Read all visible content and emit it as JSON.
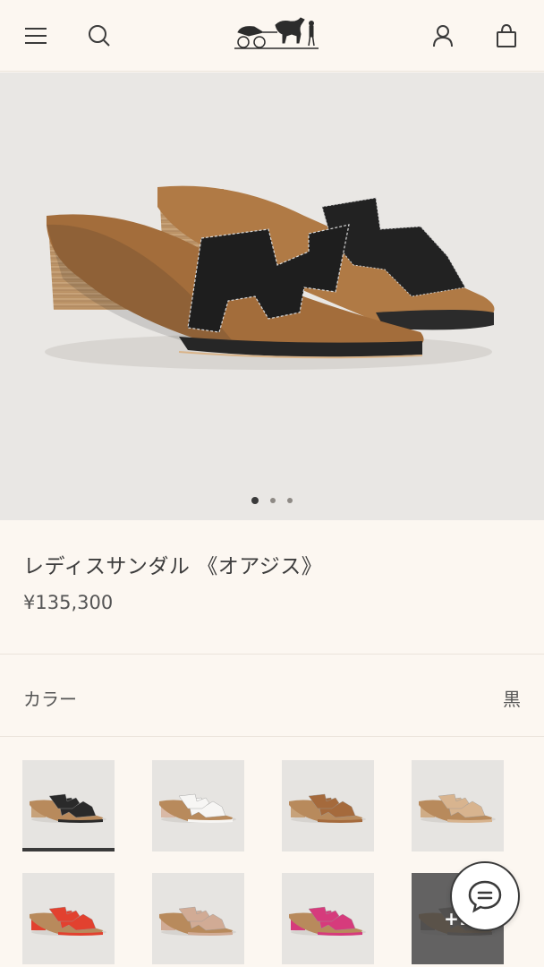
{
  "header": {
    "menu_icon": "hamburger-menu-icon",
    "search_icon": "search-icon",
    "logo": "horse-carriage-logo",
    "account_icon": "account-icon",
    "bag_icon": "shopping-bag-icon"
  },
  "gallery": {
    "image": "black-leather-heeled-sandal",
    "slides": 3,
    "active_slide": 1
  },
  "product": {
    "title": "レディスサンダル 《オアジス》",
    "price": "¥135,300"
  },
  "color": {
    "label": "カラー",
    "value": "黒"
  },
  "swatches": [
    {
      "name": "black",
      "strap": "#2a2a2a",
      "heel": "#c7a27a",
      "selected": true
    },
    {
      "name": "white",
      "strap": "#f7f6f4",
      "heel": "#d9b9a6",
      "selected": false
    },
    {
      "name": "tan",
      "strap": "#a56a3c",
      "heel": "#c7a27a",
      "selected": false
    },
    {
      "name": "beige",
      "strap": "#d8b48f",
      "heel": "#cfac86",
      "selected": false
    },
    {
      "name": "red",
      "strap": "#e2412f",
      "heel": "#e2412f",
      "selected": false
    },
    {
      "name": "rose-beige",
      "strap": "#d1ab95",
      "heel": "#d1ab95",
      "selected": false
    },
    {
      "name": "pink",
      "strap": "#d63b7c",
      "heel": "#d63b7c",
      "selected": false
    },
    {
      "name": "more",
      "strap": "#8a7f78",
      "heel": "#8a7f78",
      "selected": false
    }
  ],
  "more_label": "+1",
  "chat_icon": "chat-bubble-icon",
  "colors": {
    "background": "#fcf7f1",
    "gallery_bg": "#e9e7e4",
    "text": "#3d3d3d"
  }
}
